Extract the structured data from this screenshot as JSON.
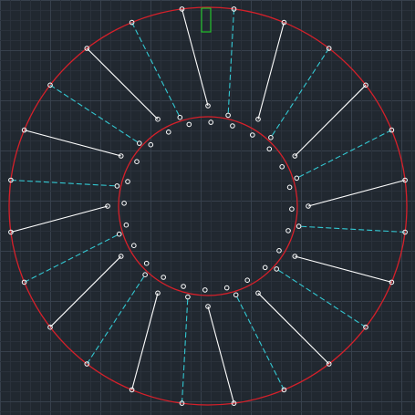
{
  "canvas": {
    "background_color": "#212830",
    "grid_minor_color": "#2a313b",
    "grid_major_color": "#37404c"
  },
  "drawing": {
    "outer_circle_color": "#d6202a",
    "inner_circle_color": "#d6202a",
    "solid_spoke_color": "#ffffff",
    "dashed_spoke_color": "#33c8d2",
    "marker_color": "#ffffff",
    "tab_color": "#22c02a",
    "solid_spoke_count": 12,
    "dashed_spoke_count": 12
  }
}
